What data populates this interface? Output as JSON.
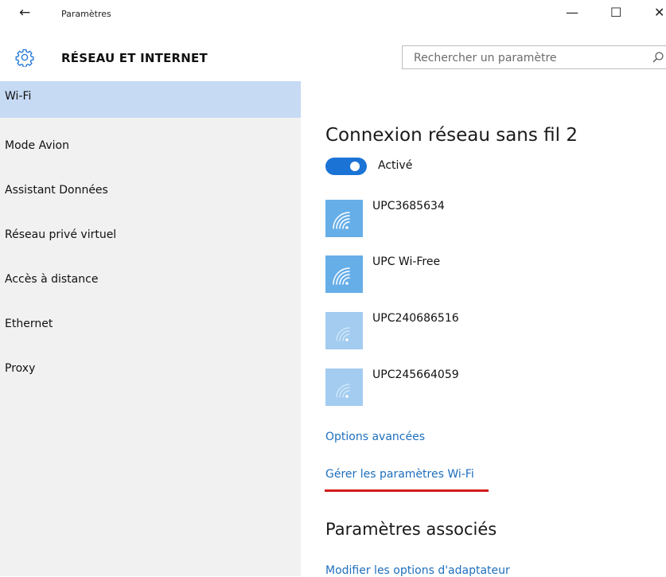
{
  "window": {
    "title": "Paramètres",
    "back_glyph": "←",
    "minimize_glyph": "—",
    "maximize_glyph": "☐",
    "close_glyph": "✕"
  },
  "header": {
    "title": "RÉSEAU ET INTERNET",
    "icon": "gear-icon",
    "search_placeholder": "Rechercher un paramètre",
    "search_icon": "search-icon"
  },
  "sidebar": {
    "items": [
      {
        "label": "Wi-Fi",
        "selected": true
      },
      {
        "label": "Mode Avion"
      },
      {
        "label": "Assistant Données"
      },
      {
        "label": "Réseau privé virtuel"
      },
      {
        "label": "Accès à distance"
      },
      {
        "label": "Ethernet"
      },
      {
        "label": "Proxy"
      }
    ]
  },
  "main": {
    "title": "Connexion réseau sans fil 2",
    "toggle_label": "Activé",
    "networks": [
      {
        "name": "UPC3685634",
        "icon": "wifi-icon"
      },
      {
        "name": "UPC Wi-Free",
        "icon": "wifi-icon"
      },
      {
        "name": "UPC240686516",
        "icon": "wifi-icon"
      },
      {
        "name": "UPC245664059",
        "icon": "wifi-icon"
      }
    ],
    "links": {
      "advanced": "Options avancées",
      "manage": "Gérer les paramètres Wi-Fi",
      "adapter": "Modifier les options d'adaptateur"
    },
    "related_title": "Paramètres associés"
  },
  "colors": {
    "accent": "#1b73d6",
    "link": "#1e6fbd",
    "selected_nav": "#c6daf4",
    "sidebar_bg": "#f1f1f1",
    "wifi_tile": "#66aee8",
    "underline": "#d31c1c"
  }
}
